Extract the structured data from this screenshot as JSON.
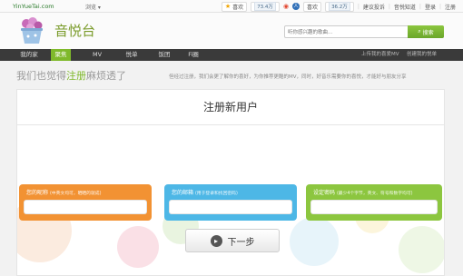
{
  "topbar": {
    "site": "YinYueTai.com",
    "browse": "浏览 ▾",
    "like1": "喜欢",
    "like1_count": "73.4万",
    "like2": "喜欢",
    "like2_count": "36.2万",
    "links": [
      "建议投诉",
      "音悦知道",
      "登录",
      "注册"
    ]
  },
  "header": {
    "logo_text": "音悦台",
    "search_placeholder": "听你感兴趣的歌曲...",
    "search_button": "搜索"
  },
  "nav": {
    "items": [
      "我的家",
      "聚焦",
      "MV",
      "悦单",
      "饭团",
      "Fi圈"
    ],
    "active_index": 1,
    "extra_left": "上传我的喜爱MV",
    "extra_right": "创建我的悦单"
  },
  "tagline": {
    "prefix": "我们也觉得",
    "highlight": "注册",
    "suffix": "麻烦透了",
    "desc": "但经过注册，我们会更了解你的喜好，为你推荐更酷的MV，同时，好音乐需要你的喜悦，才能好与朋友分享"
  },
  "form": {
    "title": "注册新用户",
    "nickname_label": "您的昵称",
    "nickname_hint": "(中英文均可，晒晒的就成)",
    "email_label": "您的邮箱",
    "email_hint": "(用于登录和找回密码)",
    "password_label": "设定密码",
    "password_hint": "(最少4个字节，英文、符号和数字均可)",
    "next_button": "下一步"
  },
  "colors": {
    "accent_green": "#7fb92b",
    "field_orange": "#f29233",
    "field_blue": "#4db7e6",
    "field_green": "#8cc63f",
    "nav_bg": "#3a3a3a"
  }
}
